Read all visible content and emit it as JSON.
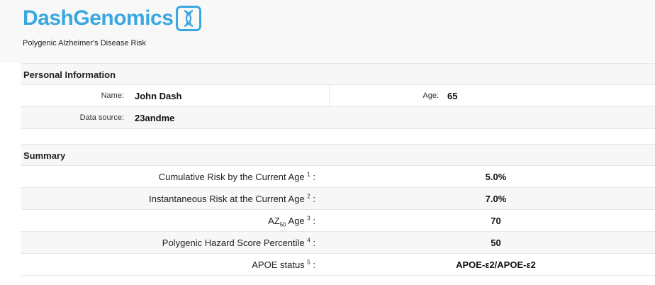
{
  "brand": {
    "name": "DashGenomics",
    "subtitle": "Polygenic Alzheimer's Disease Risk",
    "accent_color": "#3aa7e0",
    "logo_icon": "dna-helix-icon"
  },
  "personal": {
    "title": "Personal Information",
    "name_label": "Name:",
    "name_value": "John Dash",
    "age_label": "Age:",
    "age_value": "65",
    "source_label": "Data source:",
    "source_value": "23andme"
  },
  "summary": {
    "title": "Summary",
    "rows": [
      {
        "label": "Cumulative Risk by the Current Age",
        "note": "1",
        "value": "5.0%"
      },
      {
        "label": "Instantaneous Risk at the Current Age",
        "note": "2",
        "value": "7.0%"
      },
      {
        "label_prefix": "AZ",
        "label_sub": "50",
        "label_suffix": " Age",
        "note": "3",
        "value": "70"
      },
      {
        "label": "Polygenic Hazard Score Percentile",
        "note": "4",
        "value": "50"
      },
      {
        "label": "APOE status",
        "note": "5",
        "value": "APOE-ε2/APOE-ε2"
      }
    ],
    "colon": ":"
  }
}
